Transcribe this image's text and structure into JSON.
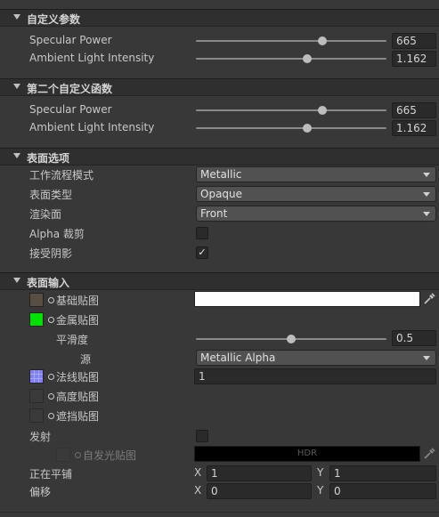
{
  "sections": {
    "custom_params": {
      "title": "自定义参数",
      "specular_label": "Specular Power",
      "specular_value": "665",
      "specular_fraction": 0.64,
      "ambient_label": "Ambient Light Intensity",
      "ambient_value": "1.162",
      "ambient_fraction": 0.58
    },
    "custom_funcs": {
      "title": "第二个自定义函数",
      "specular_label": "Specular Power",
      "specular_value": "665",
      "specular_fraction": 0.64,
      "ambient_label": "Ambient Light Intensity",
      "ambient_value": "1.162",
      "ambient_fraction": 0.58
    },
    "surface_options": {
      "title": "表面选项",
      "workflow_label": "工作流程模式",
      "workflow_value": "Metallic",
      "surface_type_label": "表面类型",
      "surface_type_value": "Opaque",
      "render_face_label": "渲染面",
      "render_face_value": "Front",
      "alpha_clip_label": "Alpha 裁剪",
      "alpha_clip_checked": false,
      "receive_shadows_label": "接受阴影",
      "receive_shadows_checked": true,
      "checkmark": "✓"
    },
    "surface_inputs": {
      "title": "表面输入",
      "base_map_label": "基础贴图",
      "base_map_swatch_color": "#5a4e43",
      "base_color": "#ffffff",
      "metallic_map_label": "金属贴图",
      "metallic_swatch_color": "#00e000",
      "smoothness_label": "平滑度",
      "smoothness_value": "0.5",
      "smoothness_fraction": 0.5,
      "source_label": "源",
      "source_value": "Metallic Alpha",
      "normal_map_label": "法线贴图",
      "normal_swatch_color": "#8080f0",
      "normal_value": "1",
      "height_map_label": "高度贴图",
      "occlusion_map_label": "遮挡贴图",
      "emission_label": "发射",
      "emission_map_label": "自发光贴图",
      "hdr_label": "HDR",
      "tiling_label": "正在平铺",
      "tiling_x_axis": "X",
      "tiling_x": "1",
      "tiling_y_axis": "Y",
      "tiling_y": "1",
      "offset_label": "偏移",
      "offset_x_axis": "X",
      "offset_x": "0",
      "offset_y_axis": "Y",
      "offset_y": "0"
    }
  },
  "colors": {
    "background": "#383838",
    "header": "#2f2f2f",
    "accent_green": "#00e000"
  }
}
